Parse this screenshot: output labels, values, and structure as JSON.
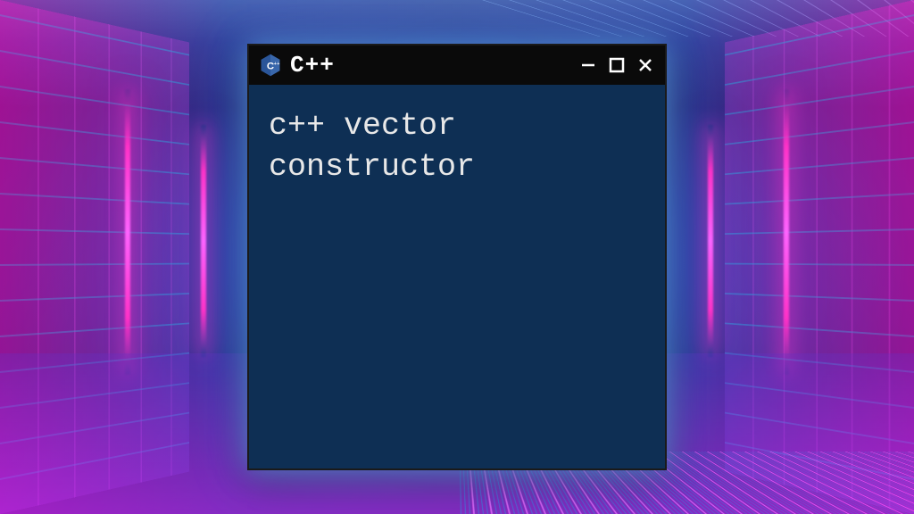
{
  "window": {
    "title": "C++",
    "icon_name": "cpp-logo"
  },
  "content": {
    "text": "c++ vector\nconstructor"
  },
  "controls": {
    "minimize": "−",
    "maximize": "□",
    "close": "✕"
  }
}
